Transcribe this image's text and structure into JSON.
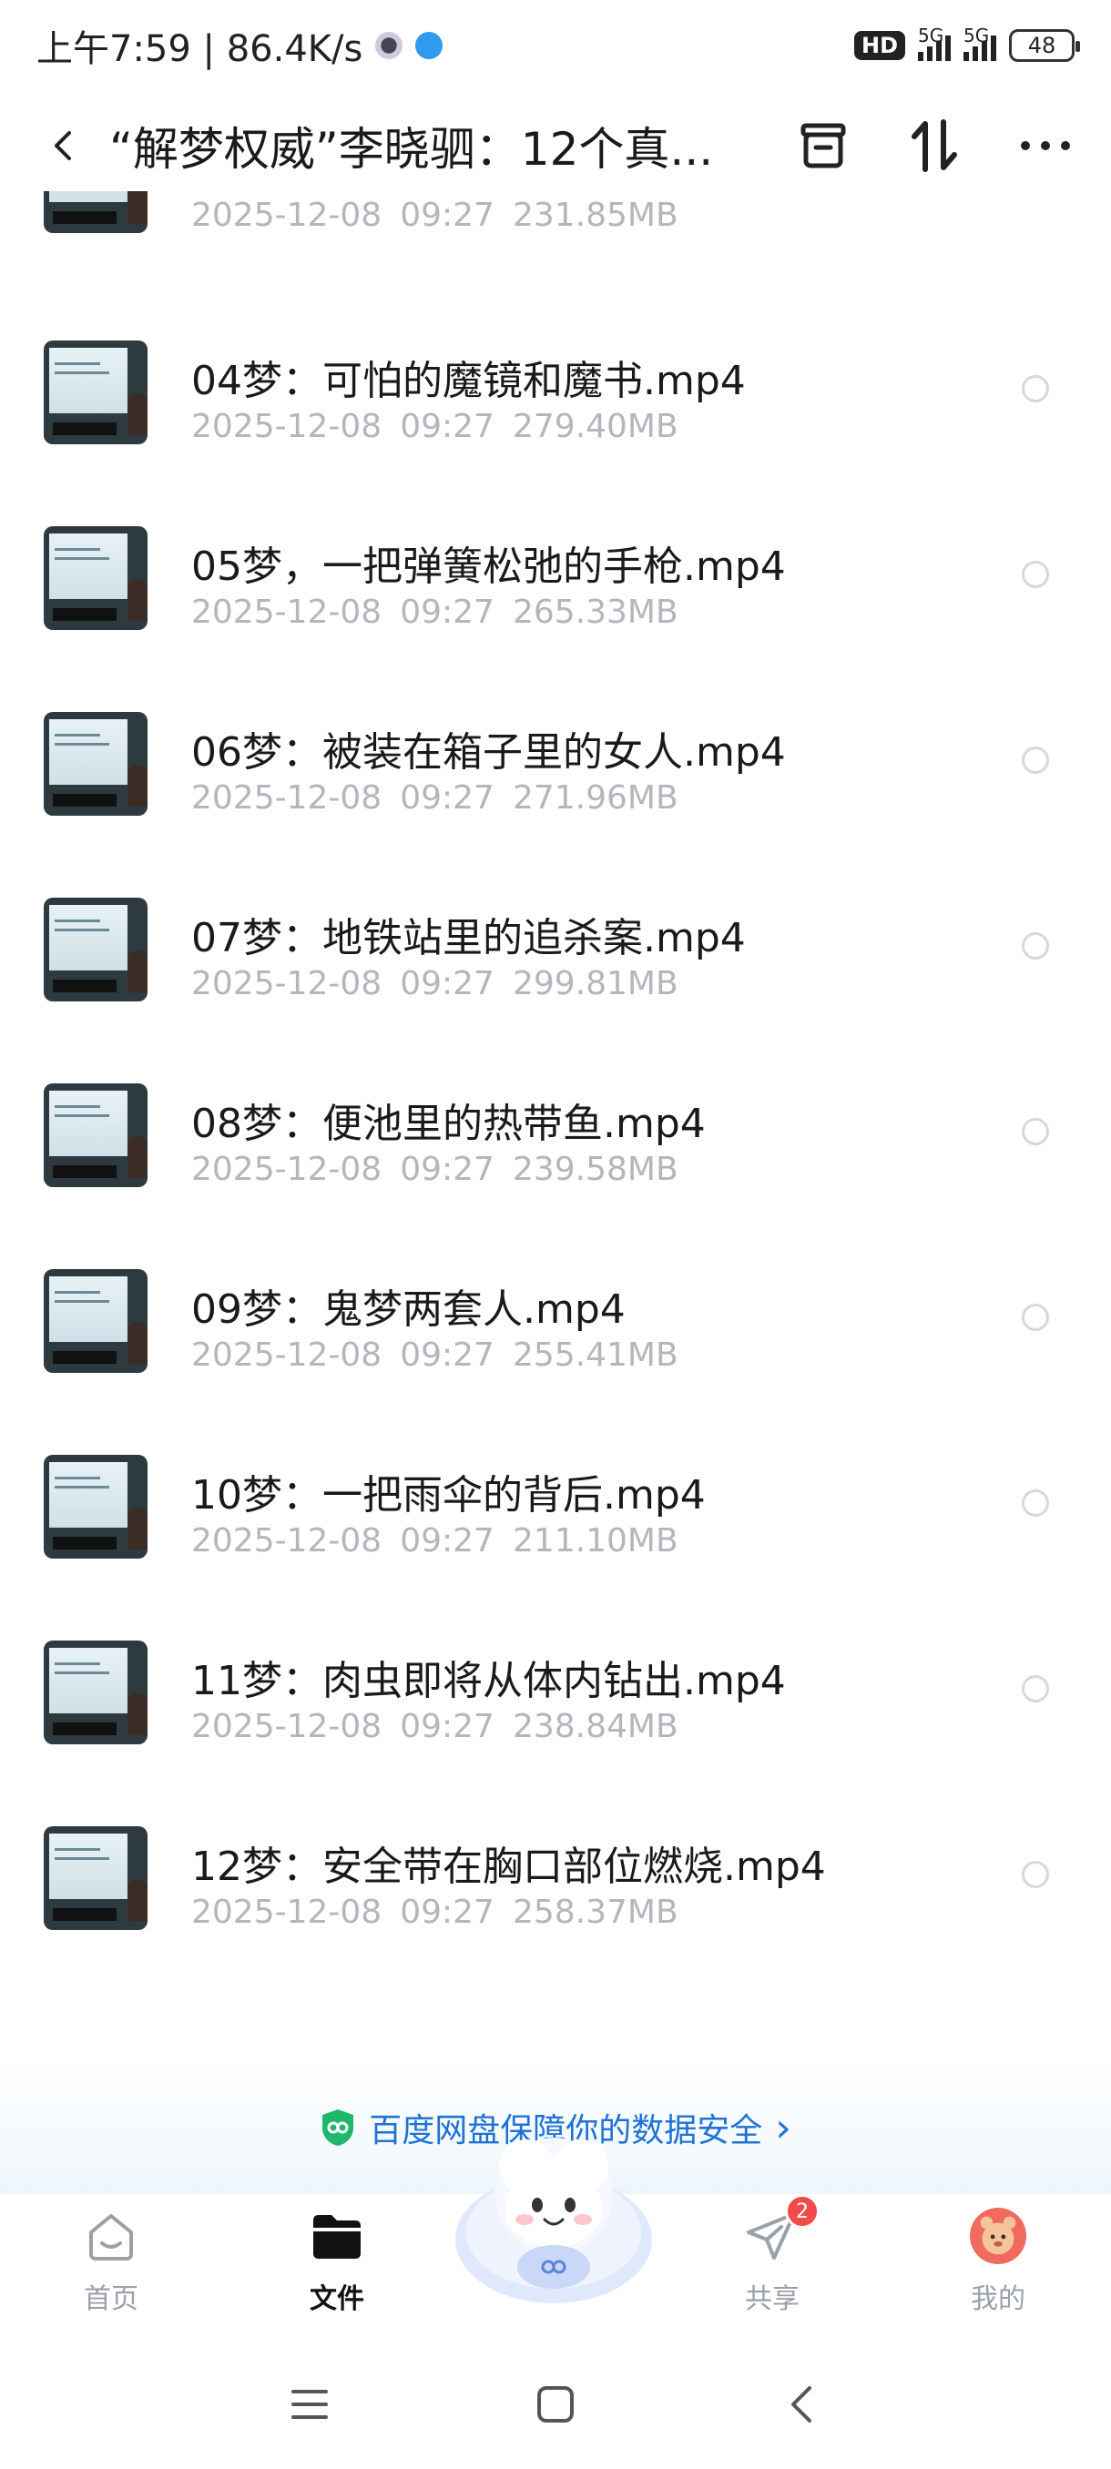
{
  "status_bar": {
    "time_speed": "上午7:59 | 86.4K/s",
    "hd_label": "HD",
    "net1": "5G",
    "net2": "5G",
    "battery": "48"
  },
  "header": {
    "title": "“解梦权威”李晓驷：12个真...",
    "icons": [
      "back-icon",
      "archive-icon",
      "sort-icon",
      "more-icon"
    ]
  },
  "files": [
    {
      "name": "",
      "date": "2025-12-08",
      "time": "09:27",
      "size": "231.85MB"
    },
    {
      "name": "04梦：可怕的魔镜和魔书.mp4",
      "date": "2025-12-08",
      "time": "09:27",
      "size": "279.40MB"
    },
    {
      "name": "05梦，一把弹簧松弛的手枪.mp4",
      "date": "2025-12-08",
      "time": "09:27",
      "size": "265.33MB"
    },
    {
      "name": "06梦：被装在箱子里的女人.mp4",
      "date": "2025-12-08",
      "time": "09:27",
      "size": "271.96MB"
    },
    {
      "name": "07梦：地铁站里的追杀案.mp4",
      "date": "2025-12-08",
      "time": "09:27",
      "size": "299.81MB"
    },
    {
      "name": "08梦：便池里的热带鱼.mp4",
      "date": "2025-12-08",
      "time": "09:27",
      "size": "239.58MB"
    },
    {
      "name": "09梦：鬼梦两套人.mp4",
      "date": "2025-12-08",
      "time": "09:27",
      "size": "255.41MB"
    },
    {
      "name": "10梦：一把雨伞的背后.mp4",
      "date": "2025-12-08",
      "time": "09:27",
      "size": "211.10MB"
    },
    {
      "name": "11梦：肉虫即将从体内钻出.mp4",
      "date": "2025-12-08",
      "time": "09:27",
      "size": "238.84MB"
    },
    {
      "name": "12梦：安全带在胸口部位燃烧.mp4",
      "date": "2025-12-08",
      "time": "09:27",
      "size": "258.37MB"
    }
  ],
  "security_banner": {
    "text": "百度网盘保障你的数据安全",
    "chevron": "›"
  },
  "bottom_nav": {
    "items": [
      {
        "label": "首页",
        "icon": "home-icon"
      },
      {
        "label": "文件",
        "icon": "folder-icon"
      },
      {
        "label": "共享",
        "icon": "share-icon",
        "badge": "2"
      },
      {
        "label": "我的",
        "icon": "profile-avatar-icon"
      }
    ]
  },
  "colors": {
    "accent": "#1e73d6",
    "badge": "#f04a4a",
    "meta_gray": "#b3b6bc"
  }
}
